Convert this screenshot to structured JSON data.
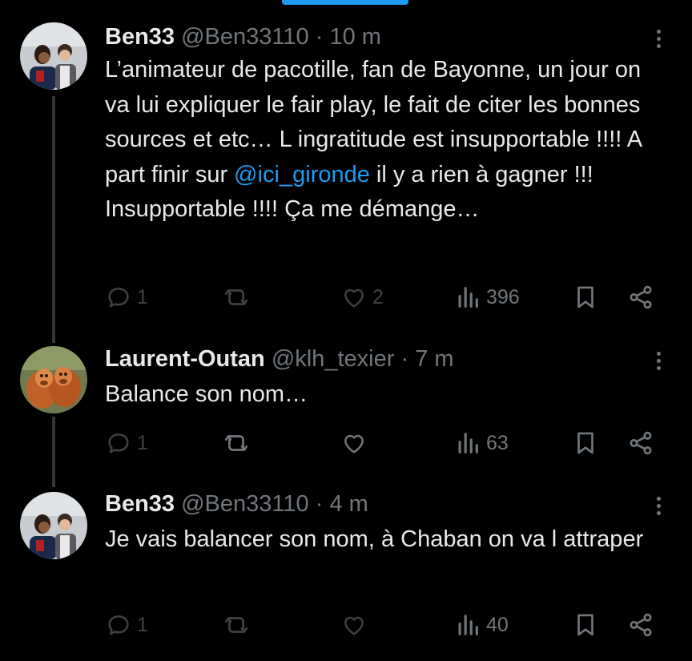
{
  "colors": {
    "background": "#000000",
    "text": "#e7e9ea",
    "muted": "#71767b",
    "accent": "#1d9bf0"
  },
  "tweets": [
    {
      "name": "Ben33",
      "handle": "@Ben33110",
      "separator": "·",
      "time": "10 m",
      "text_before": "L’animateur de pacotille, fan de Bayonne, un jour on va lui expliquer le fair play, le fait de citer les bonnes sources et etc… L ingratitude est insupportable !!!! A part finir sur ",
      "mention": "@ici_gironde",
      "text_after": " il y a rien à gagner !!! Insupportable !!!! Ça me démange…",
      "replies": "1",
      "retweets": "",
      "likes": "2",
      "views": "396",
      "avatar_icon": "photo-two-people"
    },
    {
      "name": "Laurent-Outan",
      "handle": "@klh_texier",
      "separator": "·",
      "time": "7 m",
      "text_before": "Balance son nom…",
      "mention": "",
      "text_after": "",
      "replies": "1",
      "retweets": "",
      "likes": "",
      "views": "63",
      "avatar_icon": "photo-orangutans"
    },
    {
      "name": "Ben33",
      "handle": "@Ben33110",
      "separator": "·",
      "time": "4 m",
      "text_before": "Je vais balancer son nom, à Chaban on va  l attraper",
      "mention": "",
      "text_after": "",
      "replies": "1",
      "retweets": "",
      "likes": "",
      "views": "40",
      "avatar_icon": "photo-two-people"
    }
  ]
}
